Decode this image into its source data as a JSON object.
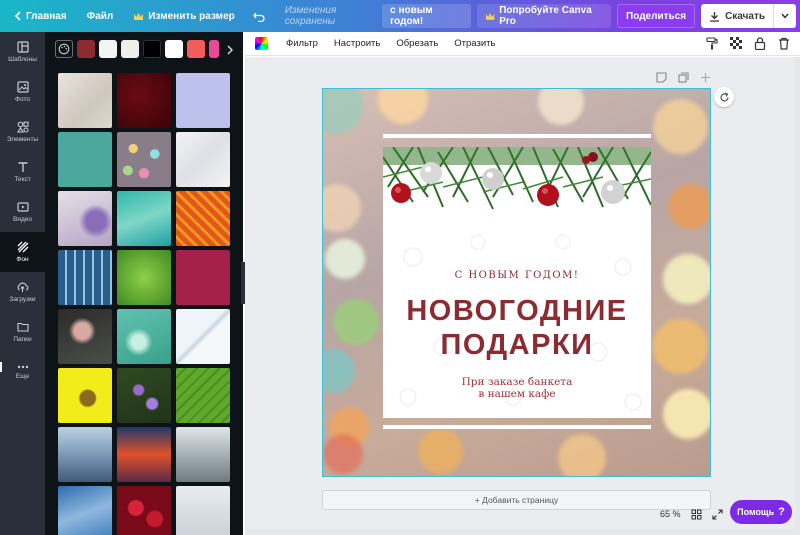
{
  "topbar": {
    "home": "Главная",
    "file": "Файл",
    "resize": "Изменить размер",
    "saved_status": "Изменения сохранены",
    "design_name": "с новым годом!",
    "try_pro": "Попробуйте Canva Pro",
    "share": "Поделиться",
    "download": "Скачать"
  },
  "leftnav": {
    "items": [
      {
        "label": "Шаблоны",
        "icon": "templates-icon"
      },
      {
        "label": "Фото",
        "icon": "photo-icon"
      },
      {
        "label": "Элементы",
        "icon": "elements-icon"
      },
      {
        "label": "Текст",
        "icon": "text-icon"
      },
      {
        "label": "Видео",
        "icon": "video-icon"
      },
      {
        "label": "Фон",
        "icon": "background-icon"
      },
      {
        "label": "Загрузки",
        "icon": "upload-icon"
      },
      {
        "label": "Папки",
        "icon": "folder-icon"
      },
      {
        "label": "Еще",
        "icon": "more-icon"
      }
    ],
    "active": "Фон"
  },
  "panel": {
    "swatches": [
      "#8d2b30",
      "#f4f4f4",
      "#eeeeea",
      "#000000",
      "#ffffff",
      "#f45b5b",
      "#e84a9a"
    ]
  },
  "toolbar": {
    "filter": "Фильтр",
    "adjust": "Настроить",
    "crop": "Обрезать",
    "flip": "Отразить"
  },
  "card": {
    "subtitle": "С НОВЫМ ГОДОМ!",
    "title_line1": "НОВОГОДНИЕ",
    "title_line2": "ПОДАРКИ",
    "body_line1": "При заказе банкета",
    "body_line2": "в нашем кафе"
  },
  "canvas": {
    "add_page": "+ Добавить страницу"
  },
  "zoom": {
    "level": "65 %"
  },
  "help": {
    "label": "Помощь",
    "icon": "?"
  },
  "colors": {
    "accent": "#7d2ae8",
    "title": "#8d2b33",
    "panel_bg": "#0e1318",
    "nav_bg": "#293039"
  }
}
